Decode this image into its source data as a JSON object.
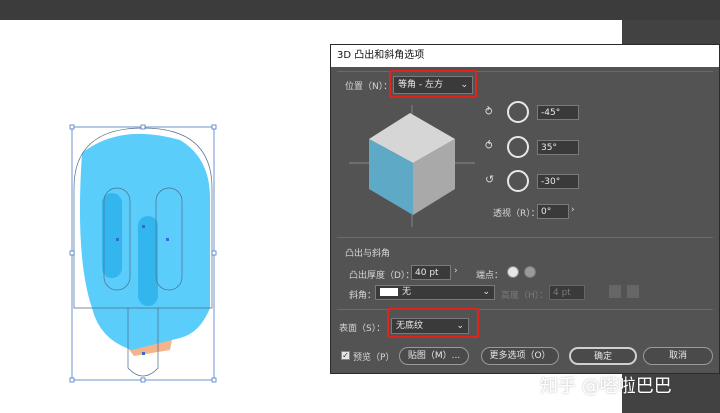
{
  "dialog": {
    "title": "3D 凸出和斜角选项",
    "position_label": "位置（N）：",
    "position_value": "等角 - 左方",
    "rotation_x": "-45°",
    "rotation_y": "35°",
    "rotation_z": "-30°",
    "perspective_label": "透视（R）：",
    "perspective_value": "0°",
    "extrude_section": "凸出与斜角",
    "extrude_depth_label": "凸出厚度（D）：",
    "extrude_depth_value": "40 pt",
    "cap_label": "端点：",
    "bevel_label": "斜角：",
    "bevel_value": "无",
    "height_label": "高度（H）：",
    "height_value": "4 pt",
    "surface_label": "表面（S）：",
    "surface_value": "无底纹",
    "preview_label": "预览（P）",
    "map_art_button": "贴图（M）...",
    "more_options_button": "更多选项（O）",
    "ok_button": "确定",
    "cancel_button": "取消"
  },
  "watermark": "知乎 @嗒啦巴巴",
  "colors": {
    "highlight": "#e0241b",
    "popsicle_blue": "#5bcdfb",
    "cube_top": "#d6d6d6",
    "cube_left": "#5ea9c5",
    "cube_right": "#a9a9a9"
  }
}
